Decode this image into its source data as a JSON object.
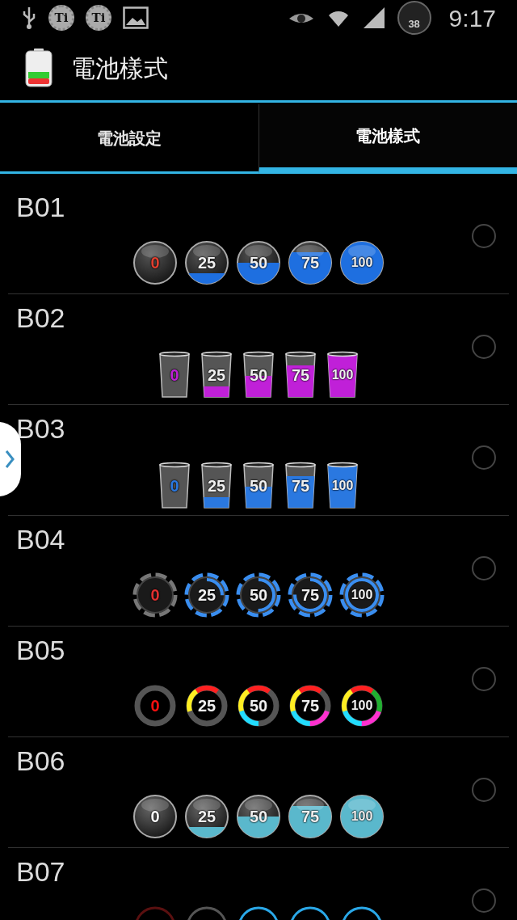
{
  "status_bar": {
    "notifications": [
      {
        "kind": "usb"
      },
      {
        "kind": "gear",
        "label": "Ti"
      },
      {
        "kind": "gear",
        "label": "Ti"
      },
      {
        "kind": "image"
      }
    ],
    "temperature": "38",
    "time": "9:17"
  },
  "action_bar": {
    "title": "電池樣式"
  },
  "tabs": [
    {
      "label": "電池設定",
      "selected": false
    },
    {
      "label": "電池樣式",
      "selected": true
    }
  ],
  "styles": [
    {
      "name": "B01",
      "kind": "sphere",
      "selected": false,
      "color": "#1e6fe0",
      "icons": [
        "0",
        "25",
        "50",
        "75",
        "100"
      ]
    },
    {
      "name": "B02",
      "kind": "cup",
      "selected": false,
      "color": "#c020d8",
      "icons": [
        "0",
        "25",
        "50",
        "75",
        "100"
      ]
    },
    {
      "name": "B03",
      "kind": "cup",
      "selected": false,
      "color": "#2a78e0",
      "icons": [
        "0",
        "25",
        "50",
        "75",
        "100"
      ]
    },
    {
      "name": "B04",
      "kind": "chip",
      "selected": false,
      "color": "#3a8ef0",
      "icons": [
        "0",
        "25",
        "50",
        "75",
        "100"
      ]
    },
    {
      "name": "B05",
      "kind": "ring",
      "selected": false,
      "color": "#ffee22",
      "icons": [
        "0",
        "25",
        "50",
        "75",
        "100"
      ]
    },
    {
      "name": "B06",
      "kind": "bubble",
      "selected": false,
      "color": "#5ab8cc",
      "icons": [
        "0",
        "25",
        "50",
        "75",
        "100"
      ]
    },
    {
      "name": "B07",
      "kind": "dial",
      "selected": false,
      "color": "#2aa8e8"
    }
  ]
}
